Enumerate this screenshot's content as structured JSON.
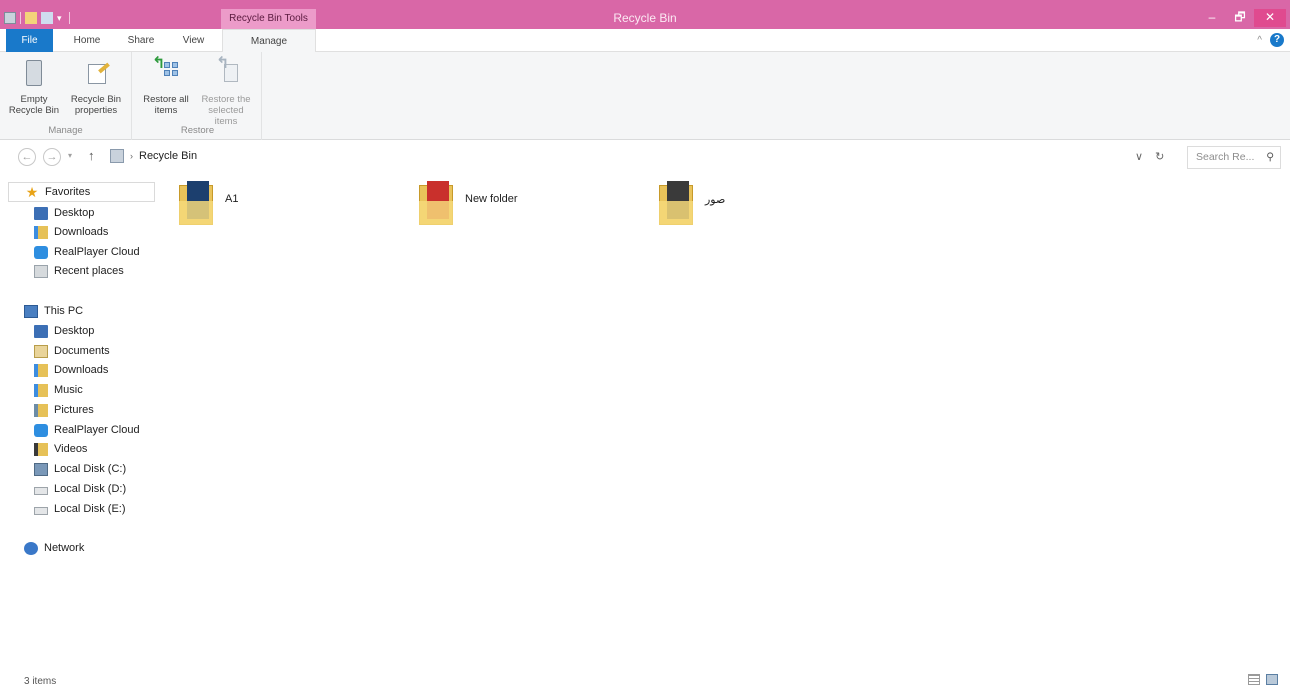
{
  "titlebar": {
    "context_tab": "Recycle Bin Tools",
    "title": "Recycle Bin",
    "minimize": "–",
    "maximize": "🗗",
    "close": "✕"
  },
  "ribbon": {
    "tabs": {
      "file": "File",
      "home": "Home",
      "share": "Share",
      "view": "View",
      "manage": "Manage"
    },
    "help": "?",
    "collapse": "^",
    "groups": {
      "manage": {
        "label": "Manage",
        "empty_recycle_bin": "Empty Recycle Bin",
        "recycle_bin_properties": "Recycle Bin properties"
      },
      "restore": {
        "label": "Restore",
        "restore_all": "Restore all items",
        "restore_selected": "Restore the selected items"
      }
    }
  },
  "address": {
    "back": "←",
    "forward": "→",
    "dropdown": "▾",
    "up": "↑",
    "crumb_separator": "›",
    "location": "Recycle Bin",
    "history_dropdown": "∨",
    "refresh": "↻",
    "search_placeholder": "Search Re...",
    "search_icon": "⚲"
  },
  "navpane": {
    "favorites": {
      "label": "Favorites",
      "items": [
        "Desktop",
        "Downloads",
        "RealPlayer Cloud",
        "Recent places"
      ]
    },
    "this_pc": {
      "label": "This PC",
      "items": [
        "Desktop",
        "Documents",
        "Downloads",
        "Music",
        "Pictures",
        "RealPlayer Cloud",
        "Videos",
        "Local Disk (C:)",
        "Local Disk (D:)",
        "Local Disk (E:)"
      ]
    },
    "network": {
      "label": "Network"
    }
  },
  "files": [
    {
      "name": "A1"
    },
    {
      "name": "New folder"
    },
    {
      "name": "صور"
    }
  ],
  "status": {
    "items_text": "3 items"
  }
}
